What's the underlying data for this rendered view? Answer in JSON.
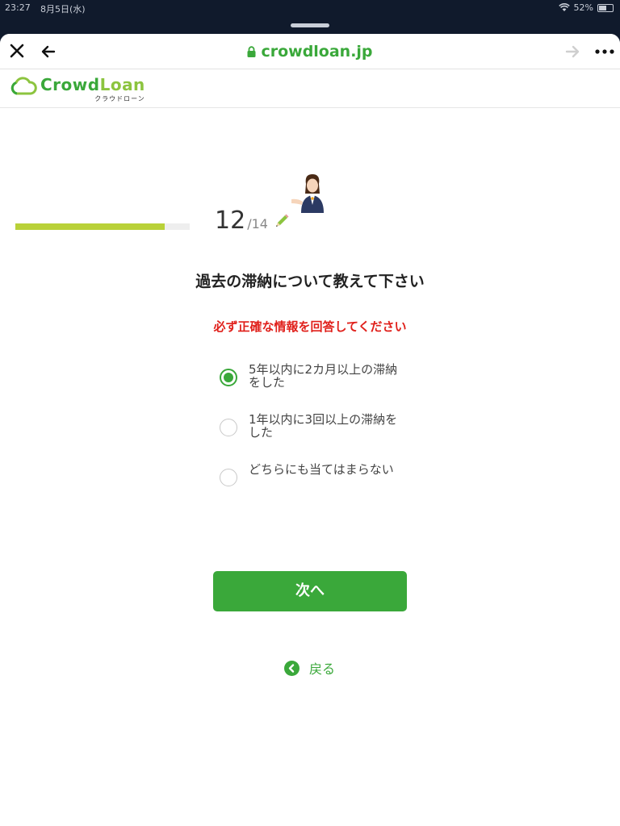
{
  "status_bar": {
    "time": "23:27",
    "date": "8月5日(水)",
    "battery": "52%"
  },
  "browser": {
    "url": "crowdloan.jp",
    "url_color": "#3aa83a"
  },
  "site": {
    "logo_part1": "Crowd",
    "logo_part2": "Loan",
    "logo_sub": "クラウドローン"
  },
  "progress": {
    "current": "12",
    "total": "/14",
    "fraction": 0.857,
    "color": "#b9d139"
  },
  "question": {
    "title": "過去の滞納について教えて下さい",
    "warning": "必ず正確な情報を回答してください",
    "options": [
      {
        "label": "5年以内に2カ月以上の滞納をした",
        "selected": true
      },
      {
        "label": "1年以内に3回以上の滞納をした",
        "selected": false
      },
      {
        "label": "どちらにも当てはまらない",
        "selected": false
      }
    ]
  },
  "buttons": {
    "next_label": "次へ",
    "back_label": "戻る"
  },
  "colors": {
    "accent": "#3aa83a",
    "warning": "#e0201b"
  }
}
